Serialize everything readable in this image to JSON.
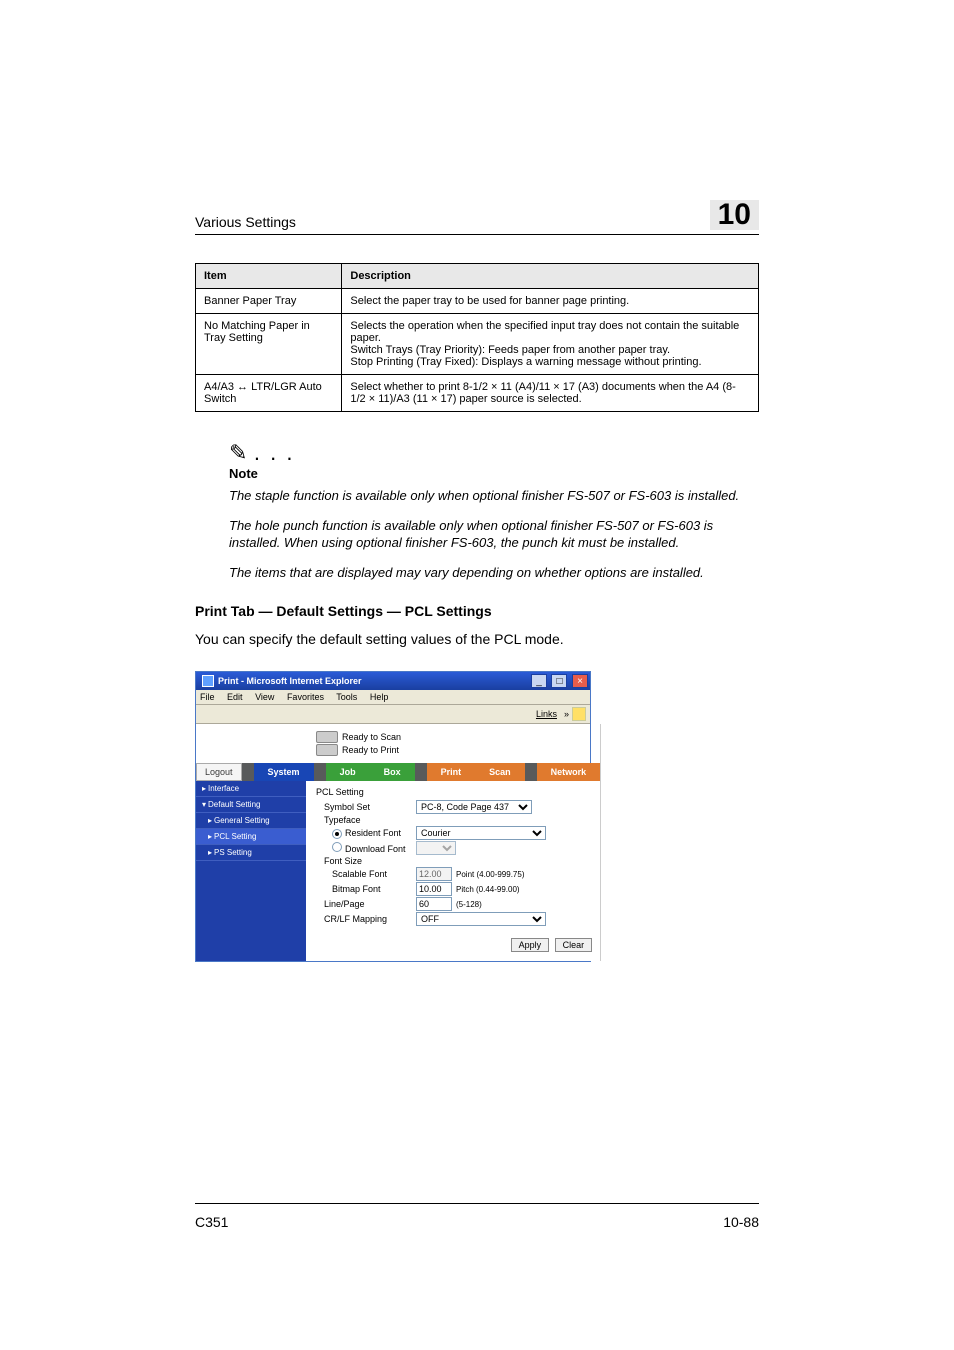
{
  "header": {
    "title": "Various Settings",
    "chapter": "10"
  },
  "table": {
    "head": {
      "c1": "Item",
      "c2": "Description"
    },
    "rows": [
      {
        "c1": "Banner Paper Tray",
        "c2": "Select the paper tray to be used for banner page printing."
      },
      {
        "c1": "No Matching Paper in Tray Setting",
        "c2": "Selects the operation when the specified input tray does not contain the suitable paper.\nSwitch Trays (Tray Priority): Feeds paper from another paper tray.\nStop Printing (Tray Fixed): Displays a warning message without printing."
      },
      {
        "c1": "A4/A3 ↔ LTR/LGR Auto Switch",
        "c2": "Select whether to print 8-1/2 × 11 (A4)/11 × 17 (A3) documents when the A4 (8-1/2 × 11)/A3 (11 × 17) paper source is selected."
      }
    ]
  },
  "note": {
    "dots": ". . .",
    "head": "Note",
    "p1": "The staple function is available only when optional finisher FS-507 or FS-603 is installed.",
    "p2": "The hole punch function is available only when optional finisher FS-507 or FS-603 is installed. When using optional finisher FS-603, the punch kit must be installed.",
    "p3": "The items that are displayed may vary depending on whether options are installed."
  },
  "section_heading": "Print Tab — Default Settings — PCL Settings",
  "body_text": "You can specify the default setting values of the PCL mode.",
  "browser": {
    "title": "Print - Microsoft Internet Explorer",
    "menu": {
      "file": "File",
      "edit": "Edit",
      "view": "View",
      "favorites": "Favorites",
      "tools": "Tools",
      "help": "Help"
    },
    "links_label": "Links",
    "status": {
      "scan": "Ready to Scan",
      "print": "Ready to Print"
    },
    "tabs": {
      "logout": "Logout",
      "system": "System",
      "job": "Job",
      "box": "Box",
      "print": "Print",
      "scan": "Scan",
      "network": "Network"
    },
    "sidebar": {
      "interface": "Interface",
      "default": "Default Setting",
      "general": "General Setting",
      "pcl": "PCL Setting",
      "ps": "PS Setting"
    },
    "form": {
      "title": "PCL Setting",
      "symbol_set": {
        "label": "Symbol Set",
        "value": "PC-8, Code Page 437"
      },
      "typeface": {
        "label": "Typeface",
        "resident": "Resident Font",
        "download": "Download Font",
        "value": "Courier"
      },
      "font_size_lbl": "Font Size",
      "scalable": {
        "label": "Scalable Font",
        "value": "12.00",
        "hint": "Point (4.00-999.75)"
      },
      "bitmap": {
        "label": "Bitmap Font",
        "value": "10.00",
        "hint": "Pitch (0.44-99.00)"
      },
      "lines": {
        "label": "Line/Page",
        "value": "60",
        "hint": "(5-128)"
      },
      "crlf": {
        "label": "CR/LF Mapping",
        "value": "OFF"
      },
      "apply": "Apply",
      "clear": "Clear"
    }
  },
  "footer": {
    "left": "C351",
    "right": "10-88"
  }
}
